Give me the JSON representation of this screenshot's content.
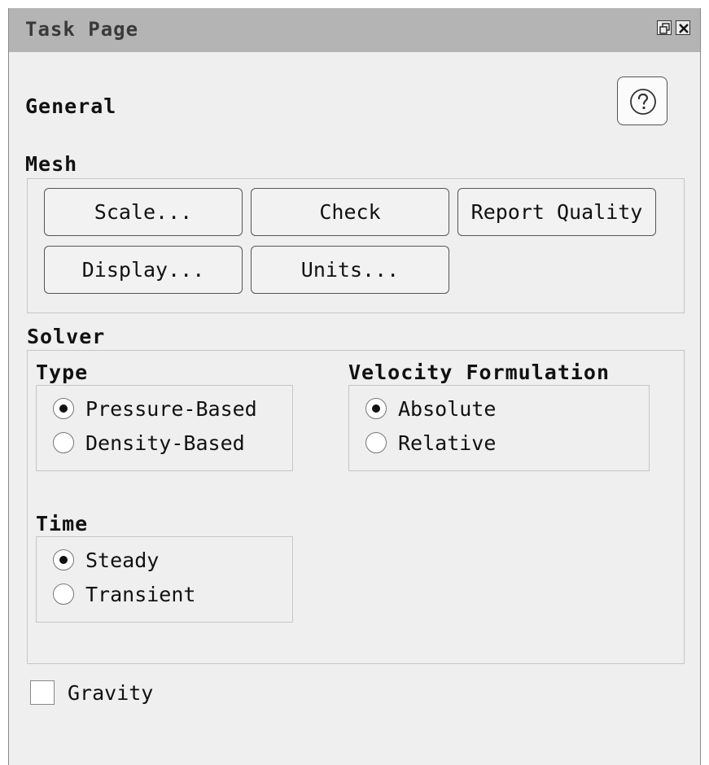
{
  "titlebar": {
    "title": "Task Page",
    "restore_icon": "restore-window-icon",
    "close_icon": "close-icon"
  },
  "general": {
    "heading": "General",
    "help_icon": "help-question-icon"
  },
  "mesh": {
    "heading": "Mesh",
    "buttons": {
      "scale": "Scale...",
      "check": "Check",
      "report_quality": "Report Quality",
      "display": "Display...",
      "units": "Units..."
    }
  },
  "solver": {
    "heading": "Solver",
    "type": {
      "heading": "Type",
      "options": [
        "Pressure-Based",
        "Density-Based"
      ],
      "selected": "Pressure-Based"
    },
    "velocity": {
      "heading": "Velocity Formulation",
      "options": [
        "Absolute",
        "Relative"
      ],
      "selected": "Absolute"
    },
    "time": {
      "heading": "Time",
      "options": [
        "Steady",
        "Transient"
      ],
      "selected": "Steady"
    }
  },
  "gravity": {
    "label": "Gravity",
    "checked": false
  }
}
